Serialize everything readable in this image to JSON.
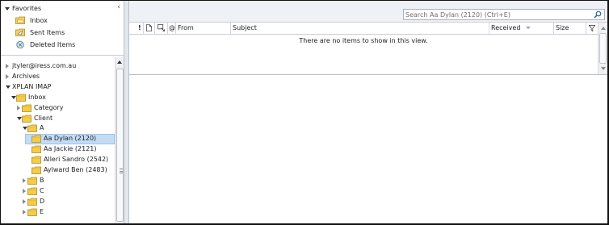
{
  "favorites": {
    "title": "Favorites",
    "collapse_glyph": "‹",
    "items": [
      {
        "label": "Inbox",
        "icon": "inbox-folder-icon"
      },
      {
        "label": "Sent Items",
        "icon": "sent-items-icon"
      },
      {
        "label": "Deleted Items",
        "icon": "deleted-items-icon"
      }
    ]
  },
  "tree": {
    "items": [
      {
        "label": "jtyler@iress.com.au",
        "state": "collapsed",
        "level": 0,
        "folder": false
      },
      {
        "label": "Archives",
        "state": "collapsed",
        "level": 0,
        "folder": false
      },
      {
        "label": "XPLAN IMAP",
        "state": "expanded",
        "level": 0,
        "folder": false
      },
      {
        "label": "Inbox",
        "state": "expanded",
        "level": 1,
        "folder": true
      },
      {
        "label": "Category",
        "state": "collapsed",
        "level": 2,
        "folder": true
      },
      {
        "label": "Client",
        "state": "expanded",
        "level": 2,
        "folder": true
      },
      {
        "label": "A",
        "state": "expanded",
        "level": 3,
        "folder": true
      },
      {
        "label": "Aa Dylan (2120)",
        "state": "none",
        "level": 4,
        "folder": true,
        "selected": true
      },
      {
        "label": "Aa Jackie (2121)",
        "state": "none",
        "level": 4,
        "folder": true
      },
      {
        "label": "Alleri Sandro (2542)",
        "state": "none",
        "level": 4,
        "folder": true
      },
      {
        "label": "Aylward Ben (2483)",
        "state": "none",
        "level": 4,
        "folder": true
      },
      {
        "label": "B",
        "state": "collapsed",
        "level": 3,
        "folder": true
      },
      {
        "label": "C",
        "state": "collapsed",
        "level": 3,
        "folder": true
      },
      {
        "label": "D",
        "state": "collapsed",
        "level": 3,
        "folder": true
      },
      {
        "label": "E",
        "state": "collapsed",
        "level": 3,
        "folder": true
      }
    ]
  },
  "search": {
    "placeholder": "Search Aa Dylan (2120) (Ctrl+E)"
  },
  "columns": {
    "importance": "!",
    "icon": "",
    "flag_icon": "",
    "attachment": "@",
    "from": "From",
    "subject": "Subject",
    "received": "Received",
    "size": "Size"
  },
  "list": {
    "empty_message": "There are no items to show in this view."
  },
  "colors": {
    "selection": "#c3dcf6",
    "folder_yellow": "#f2c94c",
    "header_bg": "#eef1f5"
  }
}
